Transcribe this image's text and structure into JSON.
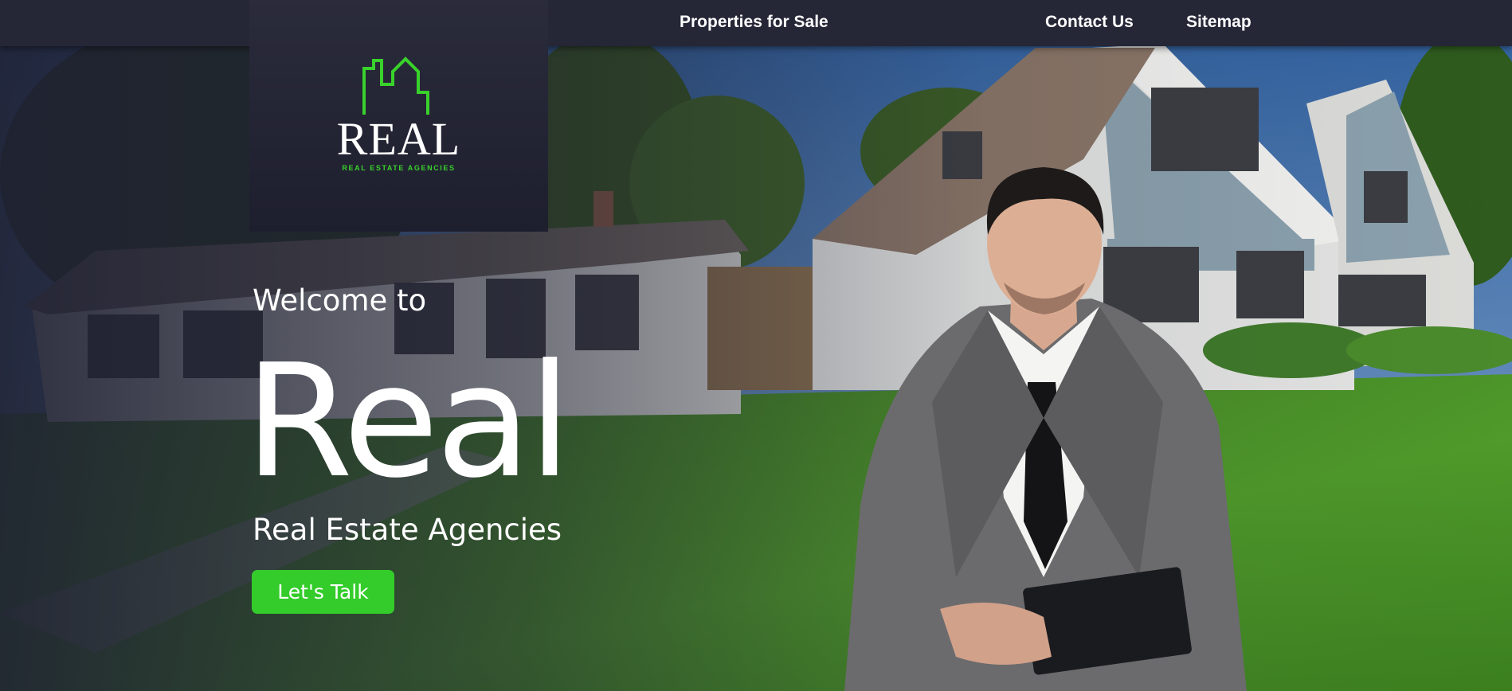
{
  "nav": {
    "items": [
      {
        "label": "Properties for Sale"
      },
      {
        "label": "Contact Us"
      },
      {
        "label": "Sitemap"
      }
    ]
  },
  "logo": {
    "word": "REAL",
    "tagline": "REAL ESTATE AGENCIES",
    "icon": "city-skyline-icon",
    "accent_color": "#39d12b"
  },
  "hero": {
    "welcome": "Welcome to",
    "headline": "Real",
    "subtitle": "Real Estate Agencies",
    "cta_label": "Let's Talk",
    "cta_color": "#33cc2a"
  }
}
